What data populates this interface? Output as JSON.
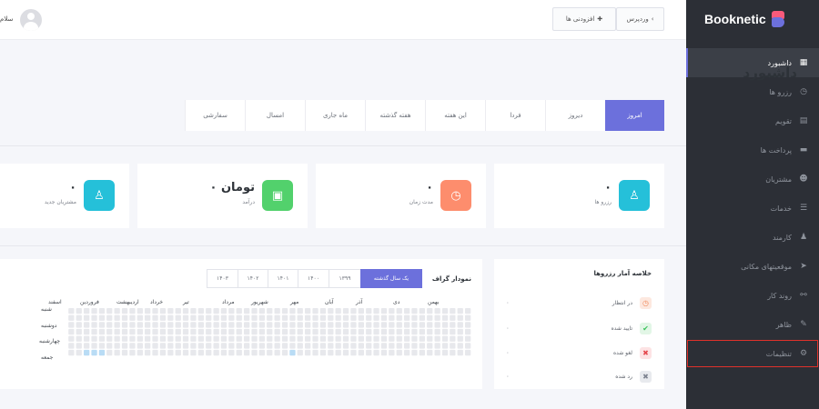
{
  "app": {
    "name": "Booknetic"
  },
  "topbar": {
    "greeting": "سلام",
    "wordpress_btn": "وردپرس",
    "wordpress_icon": "chevron-left-icon",
    "addons_btn": "افزودنی ها",
    "addons_icon": "puzzle-icon"
  },
  "sidebar": {
    "items": [
      {
        "label": "داشبورد",
        "icon": "dashboard-icon",
        "glyph": "▦",
        "active": true
      },
      {
        "label": "رزرو ها",
        "icon": "clock-icon",
        "glyph": "◷"
      },
      {
        "label": "تقویم",
        "icon": "calendar-icon",
        "glyph": "▤"
      },
      {
        "label": "پرداخت ها",
        "icon": "payments-icon",
        "glyph": "▬"
      },
      {
        "label": "مشتریان",
        "icon": "users-icon",
        "glyph": "☻"
      },
      {
        "label": "خدمات",
        "icon": "services-icon",
        "glyph": "☰"
      },
      {
        "label": "کارمند",
        "icon": "staff-icon",
        "glyph": "♟"
      },
      {
        "label": "موقعیتهای مکانی",
        "icon": "location-icon",
        "glyph": "➤"
      },
      {
        "label": "روند کار",
        "icon": "workflow-icon",
        "glyph": "⚯"
      },
      {
        "label": "ظاهر",
        "icon": "brush-icon",
        "glyph": "✎"
      },
      {
        "label": "تنظیمات",
        "icon": "gear-icon",
        "glyph": "⚙",
        "highlight": true
      }
    ]
  },
  "dashboard": {
    "title": "داشبورد",
    "tabs": [
      "امروز",
      "دیروز",
      "فردا",
      "این هفته",
      "هفته گذشته",
      "ماه جاری",
      "امسال",
      "سفارشی"
    ],
    "active_tab": 0,
    "cards": [
      {
        "value": "۰",
        "label": "رزرو ها",
        "icon": "user-icon",
        "glyph": "♙",
        "color": "#25c0d9"
      },
      {
        "value": "۰",
        "label": "مدت زمان",
        "icon": "clock-icon",
        "glyph": "◷",
        "color": "#fd8d6d"
      },
      {
        "value": "۰ تومان",
        "label": "درآمد",
        "icon": "wallet-icon",
        "glyph": "▣",
        "color": "#52d16c"
      },
      {
        "value": "۰",
        "label": "مشتریان جدید",
        "icon": "user-icon",
        "glyph": "♙",
        "color": "#25c0d9"
      }
    ]
  },
  "summary": {
    "title": "خلاصه آمار رزروها",
    "rows": [
      {
        "label": "در انتظار",
        "value": "۰",
        "icon": "clock-icon",
        "glyph": "◷",
        "color": "#f08a5d",
        "bg": "#fde8df"
      },
      {
        "label": "تایید شده",
        "value": "۰",
        "icon": "check-icon",
        "glyph": "✔",
        "color": "#3ac25b",
        "bg": "#e2f6e6"
      },
      {
        "label": "لغو شده",
        "value": "۰",
        "icon": "cross-icon",
        "glyph": "✖",
        "color": "#e5484d",
        "bg": "#fde3e4"
      },
      {
        "label": "رد شده",
        "value": "۰",
        "icon": "cross-icon",
        "glyph": "✖",
        "color": "#7d8390",
        "bg": "#e8eaee"
      }
    ]
  },
  "chart": {
    "title": "نمودار گراف",
    "year_tabs": [
      "یک سال گذشته",
      "۱۳۹۹",
      "۱۴۰۰",
      "۱۴۰۱",
      "۱۴۰۲",
      "۱۴۰۳"
    ],
    "active_year": 0,
    "cell_color": "#e7e8ec",
    "active_cell_color": "#b9dcf5"
  },
  "chart_data": {
    "type": "heatmap",
    "x_labels": [
      "بهمن",
      "دی",
      "آذر",
      "آبان",
      "مهر",
      "شهریور",
      "مرداد",
      "تیر",
      "خرداد",
      "اردیبهشت",
      "فروردین",
      "اسفند"
    ],
    "y_labels": [
      "شنبه",
      "دوشنبه",
      "چهارشنبه",
      "جمعه"
    ],
    "weeks": 53,
    "days": 7,
    "highlighted": [
      [
        2,
        6
      ],
      [
        3,
        6
      ],
      [
        4,
        6
      ],
      [
        29,
        6
      ]
    ]
  }
}
